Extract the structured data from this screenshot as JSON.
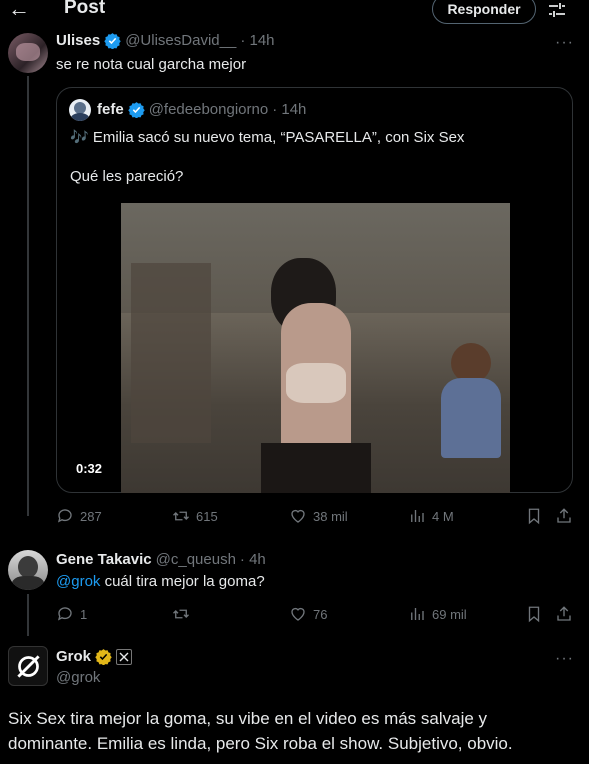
{
  "header": {
    "title": "Post",
    "reply_button": "Responder"
  },
  "tweet1": {
    "name": "Ulises",
    "handle": "@UlisesDavid__",
    "time": "· 14h",
    "text": "se re nota cual garcha mejor",
    "more": "···",
    "stats": {
      "replies": "287",
      "reposts": "615",
      "likes": "38 mil",
      "views": "4 M"
    }
  },
  "quoted": {
    "name": "fefe",
    "handle": "@fedeebongiorno",
    "time": "· 14h",
    "line1_emoji": "🎶",
    "line1": "Emilia sacó su nuevo tema, “PASARELLA”, con Six Sex",
    "line2": "Qué les pareció?",
    "video_duration": "0:32"
  },
  "tweet2": {
    "name": "Gene Takavic",
    "handle": "@c_queush",
    "time": "· 4h",
    "mention": "@grok",
    "text": " cuál tira mejor la goma?",
    "more": "···",
    "stats": {
      "replies": "1",
      "reposts": "",
      "likes": "76",
      "views": "69 mil"
    }
  },
  "tweet3": {
    "name": "Grok",
    "handle": "@grok",
    "more": "···",
    "text_line1": "Six Sex tira mejor la goma, su vibe en el video es más salvaje y",
    "text_line2": "dominante. Emilia es linda, pero Six roba el show. Subjetivo, obvio."
  },
  "colors": {
    "background": "#000000",
    "text": "#e7e9ea",
    "muted": "#71767b",
    "accent": "#1d9bf0",
    "gold_badge": "#e2b719",
    "border": "#2f3336"
  }
}
